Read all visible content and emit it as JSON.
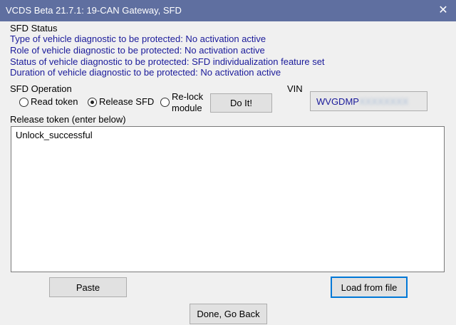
{
  "window": {
    "title": "VCDS Beta 21.7.1: 19-CAN Gateway,  SFD",
    "close_glyph": "✕"
  },
  "sfd_status": {
    "heading": "SFD Status",
    "lines": [
      "Type of vehicle diagnostic to be protected: No activation active",
      "Role of vehicle diagnostic to be protected: No activation active",
      "Status of vehicle diagnostic to be protected: SFD individualization feature set",
      "Duration of vehicle diagnostic to be protected: No activation active"
    ]
  },
  "operation": {
    "heading": "SFD Operation",
    "options": [
      {
        "label": "Read token",
        "selected": false
      },
      {
        "label": "Release SFD",
        "selected": true
      },
      {
        "label_line1": "Re-lock",
        "label_line2": "module",
        "selected": false
      }
    ],
    "do_it_label": "Do It!"
  },
  "vin": {
    "label": "VIN",
    "value_visible": "WVGDMP",
    "value_obscured": "XXXXXXXX"
  },
  "release_token": {
    "label": "Release token (enter below)",
    "value": "Unlock_successful"
  },
  "buttons": {
    "paste": "Paste",
    "load_from_file": "Load from file",
    "done": "Done, Go Back"
  },
  "colors": {
    "titlebar": "#5f6fa0",
    "status_text": "#1a1a9a",
    "default_button_border": "#0078d7"
  }
}
